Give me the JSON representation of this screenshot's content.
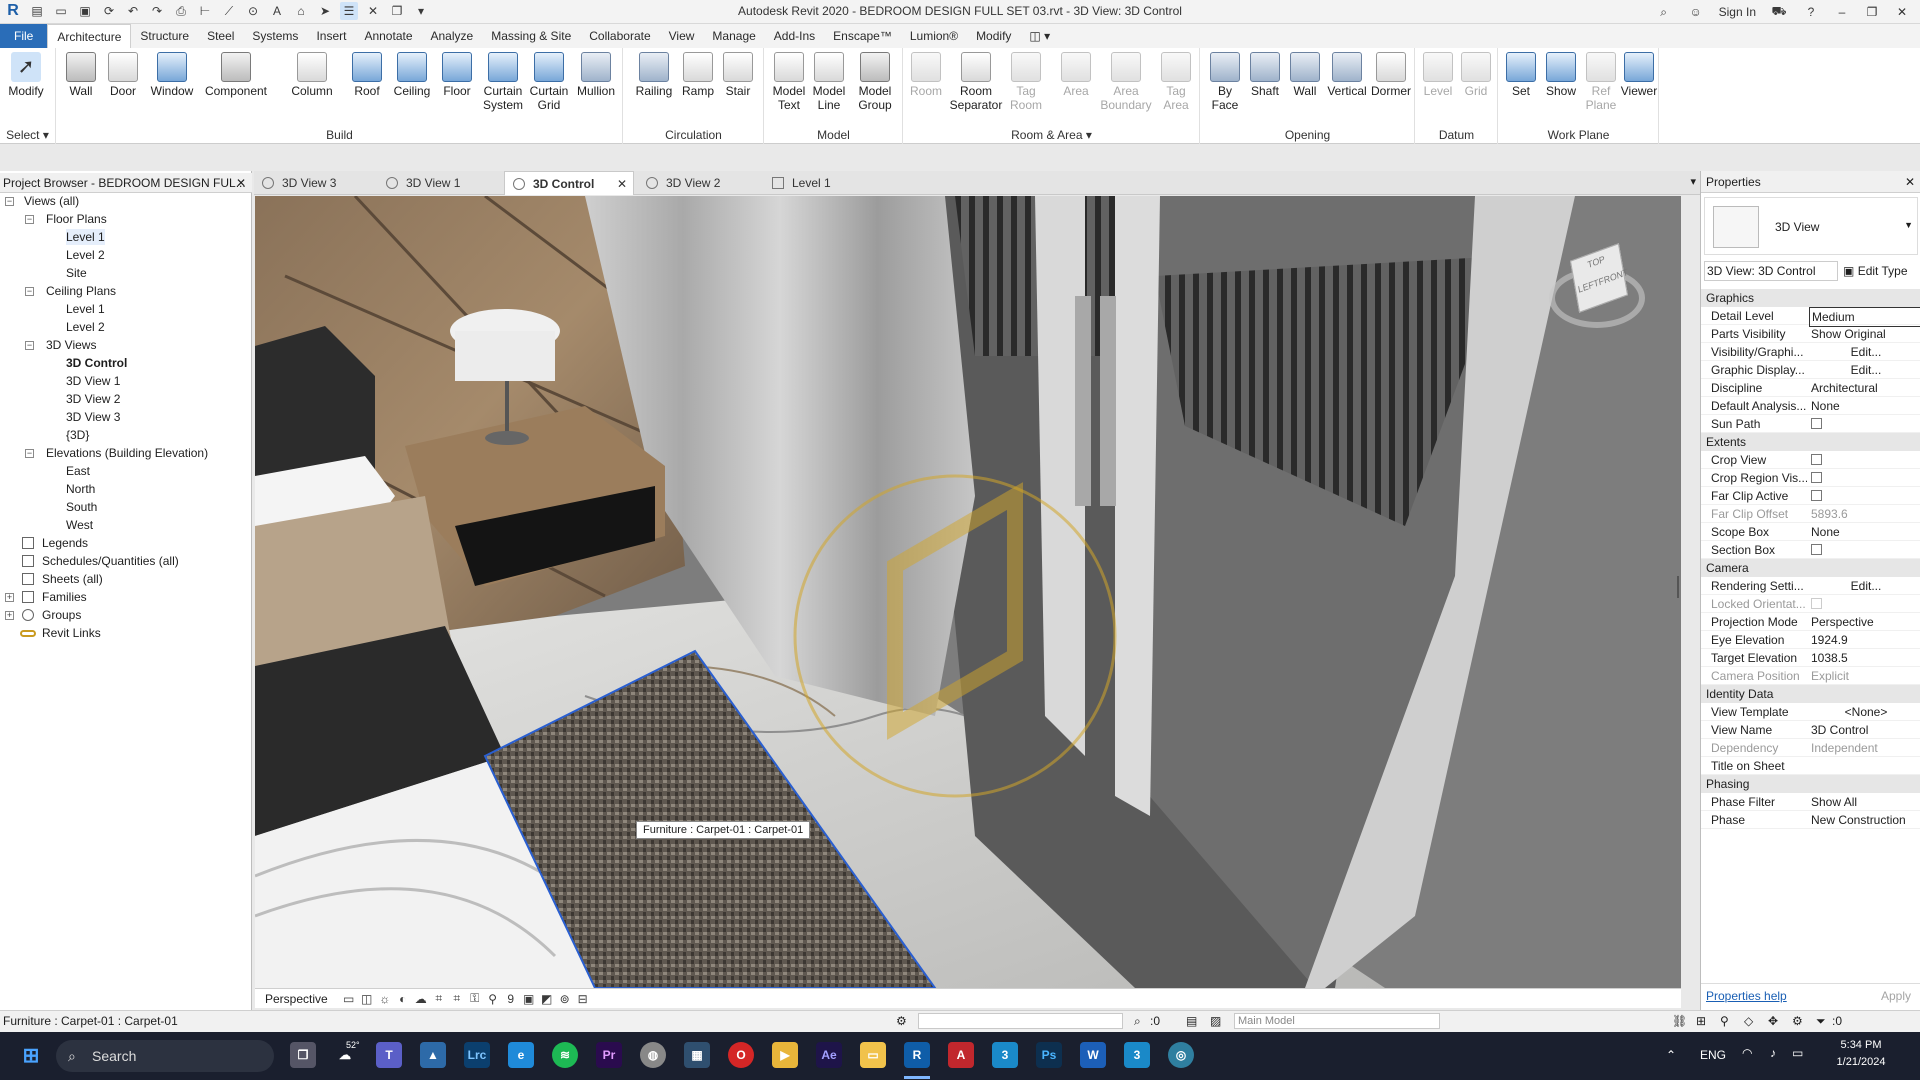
{
  "titlebar": {
    "title": "Autodesk Revit 2020 - BEDROOM DESIGN FULL SET 03.rvt - 3D View: 3D Control",
    "signin": "Sign In"
  },
  "menu": {
    "tabs": [
      "File",
      "Architecture",
      "Structure",
      "Steel",
      "Systems",
      "Insert",
      "Annotate",
      "Analyze",
      "Massing & Site",
      "Collaborate",
      "View",
      "Manage",
      "Add-Ins",
      "Enscape™",
      "Lumion®",
      "Modify"
    ]
  },
  "ribbon": {
    "select": {
      "modify": "Modify",
      "select_label": "Select ▾"
    },
    "build": {
      "title": "Build",
      "buttons": [
        "Wall",
        "Door",
        "Window",
        "Component",
        "Column",
        "Roof",
        "Ceiling",
        "Floor",
        "Curtain System",
        "Curtain Grid",
        "Mullion"
      ]
    },
    "circulation": {
      "title": "Circulation",
      "buttons": [
        "Railing",
        "Ramp",
        "Stair"
      ]
    },
    "model": {
      "title": "Model",
      "buttons": [
        "Model Text",
        "Model Line",
        "Model Group"
      ]
    },
    "room_area": {
      "title": "Room & Area ▾",
      "buttons": [
        "Room",
        "Room Separator",
        "Tag Room",
        "Area",
        "Area Boundary",
        "Tag Area"
      ]
    },
    "opening": {
      "title": "Opening",
      "buttons": [
        "By Face",
        "Shaft",
        "Wall",
        "Vertical",
        "Dormer"
      ]
    },
    "datum": {
      "title": "Datum",
      "buttons": [
        "Level",
        "Grid"
      ]
    },
    "workplane": {
      "title": "Work Plane",
      "buttons": [
        "Set",
        "Show",
        "Ref Plane",
        "Viewer"
      ]
    }
  },
  "project_browser": {
    "title": "Project Browser - BEDROOM DESIGN FUL...",
    "items": [
      {
        "label": "Views (all)"
      },
      {
        "label": "Floor Plans"
      },
      {
        "label": "Level 1"
      },
      {
        "label": "Level 2"
      },
      {
        "label": "Site"
      },
      {
        "label": "Ceiling Plans"
      },
      {
        "label": "Level 1"
      },
      {
        "label": "Level 2"
      },
      {
        "label": "3D Views"
      },
      {
        "label": "3D Control"
      },
      {
        "label": "3D View 1"
      },
      {
        "label": "3D View 2"
      },
      {
        "label": "3D View 3"
      },
      {
        "label": "{3D}"
      },
      {
        "label": "Elevations (Building Elevation)"
      },
      {
        "label": "East"
      },
      {
        "label": "North"
      },
      {
        "label": "South"
      },
      {
        "label": "West"
      },
      {
        "label": "Legends"
      },
      {
        "label": "Schedules/Quantities (all)"
      },
      {
        "label": "Sheets (all)"
      },
      {
        "label": "Families"
      },
      {
        "label": "Groups"
      },
      {
        "label": "Revit Links"
      }
    ]
  },
  "view_tabs": [
    "3D View 3",
    "3D View 1",
    "3D Control",
    "3D View 2",
    "Level 1"
  ],
  "viewport": {
    "tooltip": "Furniture : Carpet-01 : Carpet-01",
    "viewcube_top": "TOP",
    "viewcube_front": "FRONT",
    "viewcube_left": "LEFT",
    "view_mode": "Perspective",
    "scale_hint": "9"
  },
  "properties": {
    "title": "Properties",
    "type_name": "3D View",
    "selector": "3D View: 3D Control",
    "edit_type": "Edit Type",
    "groups": {
      "graphics": "Graphics",
      "extents": "Extents",
      "camera": "Camera",
      "identity": "Identity Data",
      "phasing": "Phasing"
    },
    "rows": {
      "detail_level": [
        "Detail Level",
        "Medium"
      ],
      "parts_visibility": [
        "Parts Visibility",
        "Show Original"
      ],
      "visibility_graphics": [
        "Visibility/Graphi...",
        "Edit..."
      ],
      "graphic_display": [
        "Graphic Display...",
        "Edit..."
      ],
      "discipline": [
        "Discipline",
        "Architectural"
      ],
      "default_analysis": [
        "Default Analysis...",
        "None"
      ],
      "sun_path": [
        "Sun Path",
        ""
      ],
      "crop_view": [
        "Crop View",
        ""
      ],
      "crop_region": [
        "Crop Region Vis...",
        ""
      ],
      "far_clip_active": [
        "Far Clip Active",
        ""
      ],
      "far_clip_offset": [
        "Far Clip Offset",
        "5893.6"
      ],
      "scope_box": [
        "Scope Box",
        "None"
      ],
      "section_box": [
        "Section Box",
        ""
      ],
      "rendering_settings": [
        "Rendering Setti...",
        "Edit..."
      ],
      "locked_orientation": [
        "Locked Orientat...",
        ""
      ],
      "projection_mode": [
        "Projection Mode",
        "Perspective"
      ],
      "eye_elevation": [
        "Eye Elevation",
        "1924.9"
      ],
      "target_elevation": [
        "Target Elevation",
        "1038.5"
      ],
      "camera_position": [
        "Camera Position",
        "Explicit"
      ],
      "view_template": [
        "View Template",
        "<None>"
      ],
      "view_name": [
        "View Name",
        "3D Control"
      ],
      "dependency": [
        "Dependency",
        "Independent"
      ],
      "title_on_sheet": [
        "Title on Sheet",
        ""
      ],
      "phase_filter": [
        "Phase Filter",
        "Show All"
      ],
      "phase": [
        "Phase",
        "New Construction"
      ]
    },
    "help": "Properties help",
    "apply": "Apply"
  },
  "statusbar": {
    "text": "Furniture : Carpet-01 : Carpet-01",
    "workset_count": ":0",
    "model": "Main Model",
    "filter_count": ":0"
  },
  "taskbar": {
    "search": "Search",
    "temp": "52°",
    "lang": "ENG",
    "time": "5:34 PM",
    "date": "1/21/2024"
  }
}
